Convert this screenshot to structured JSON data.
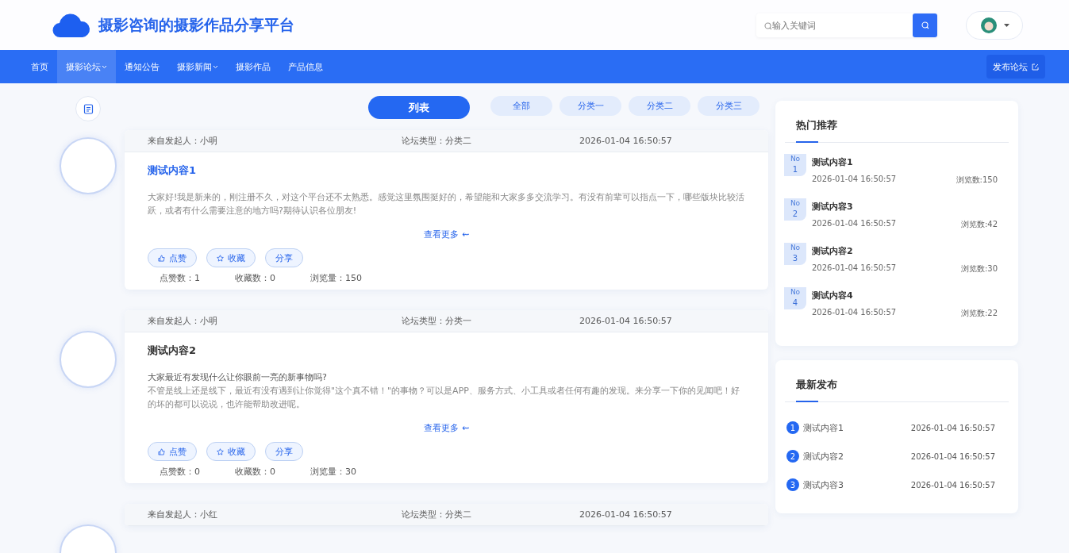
{
  "site": {
    "title": "摄影咨询的摄影作品分享平台"
  },
  "search": {
    "placeholder": "输入关键词"
  },
  "nav": [
    {
      "label": "首页",
      "selected": false,
      "dropdown": false
    },
    {
      "label": "摄影论坛",
      "selected": true,
      "dropdown": true
    },
    {
      "label": "通知公告",
      "selected": false,
      "dropdown": false
    },
    {
      "label": "摄影新闻",
      "selected": false,
      "dropdown": true
    },
    {
      "label": "摄影作品",
      "selected": false,
      "dropdown": false
    },
    {
      "label": "产品信息",
      "selected": false,
      "dropdown": false
    }
  ],
  "publish_button": "发布论坛",
  "view_tabs": [
    {
      "label": "列表",
      "selected": true
    }
  ],
  "categories": [
    {
      "label": "全部",
      "selected": false
    },
    {
      "label": "分类一",
      "selected": false
    },
    {
      "label": "分类二",
      "selected": false
    },
    {
      "label": "分类三",
      "selected": false
    }
  ],
  "posts": [
    {
      "author": "来自发起人：小明",
      "type": "论坛类型：分类二",
      "time": "2026-01-04 16:50:57",
      "title": "测试内容1",
      "highlighted": true,
      "body": [
        "大家好!我是新来的，刚注册不久，对这个平台还不太熟悉。感觉这里氛围挺好的，希望能和大家多多交流学习。有没有前辈可以指点一下，哪些版块比较活跃，或者有什么需要注意的地方吗?期待认识各位朋友!"
      ],
      "more": "查看更多",
      "more_icon": "⇜",
      "actions": [
        "点赞",
        "收藏",
        "分享"
      ],
      "stats": [
        "点赞数：1",
        "收藏数：0",
        "浏览量：150"
      ]
    },
    {
      "author": "来自发起人：小明",
      "type": "论坛类型：分类一",
      "time": "2026-01-04 16:50:57",
      "title": "测试内容2",
      "highlighted": false,
      "body": [
        "大家最近有发现什么让你眼前一亮的新事物吗?",
        "不管是线上还是线下，最近有没有遇到让你觉得\"这个真不错！\"的事物？可以是APP、服务方式、小工具或者任何有趣的发现。来分享一下你的见闻吧！好的坏的都可以说说，也许能帮助改进呢。"
      ],
      "more": "查看更多",
      "more_icon": "⇜",
      "actions": [
        "点赞",
        "收藏",
        "分享"
      ],
      "stats": [
        "点赞数：0",
        "收藏数：0",
        "浏览量：30"
      ]
    },
    {
      "author": "来自发起人：小红",
      "type": "论坛类型：分类二",
      "time": "2026-01-04 16:50:57"
    }
  ],
  "hot": {
    "title": "热门推荐",
    "items": [
      {
        "rank_label": "No",
        "rank": "1",
        "title": "测试内容1",
        "time": "2026-01-04 16:50:57",
        "views": "浏览数:150"
      },
      {
        "rank_label": "No",
        "rank": "2",
        "title": "测试内容3",
        "time": "2026-01-04 16:50:57",
        "views": "浏览数:42"
      },
      {
        "rank_label": "No",
        "rank": "3",
        "title": "测试内容2",
        "time": "2026-01-04 16:50:57",
        "views": "浏览数:30"
      },
      {
        "rank_label": "No",
        "rank": "4",
        "title": "测试内容4",
        "time": "2026-01-04 16:50:57",
        "views": "浏览数:22"
      }
    ]
  },
  "latest": {
    "title": "最新发布",
    "items": [
      {
        "rank": "1",
        "title": "测试内容1",
        "time": "2026-01-04 16:50:57"
      },
      {
        "rank": "2",
        "title": "测试内容2",
        "time": "2026-01-04 16:50:57"
      },
      {
        "rank": "3",
        "title": "测试内容3",
        "time": "2026-01-04 16:50:57"
      }
    ]
  }
}
